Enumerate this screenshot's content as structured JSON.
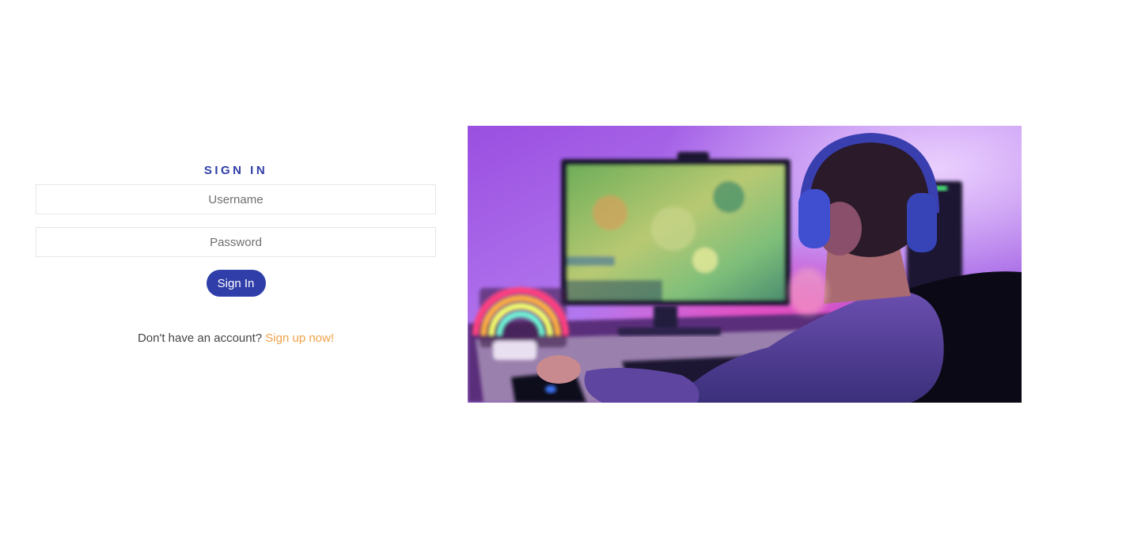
{
  "signin": {
    "title": "SIGN IN",
    "username_placeholder": "Username",
    "password_placeholder": "Password",
    "button_label": "Sign In",
    "signup_prompt": "Don't have an account?",
    "signup_link": "Sign up now!"
  },
  "hero": {
    "image_icon": "gamer-photo"
  },
  "colors": {
    "accent": "#2f3ea8",
    "link": "#f0a24a",
    "input_border": "#e6e6e6"
  }
}
